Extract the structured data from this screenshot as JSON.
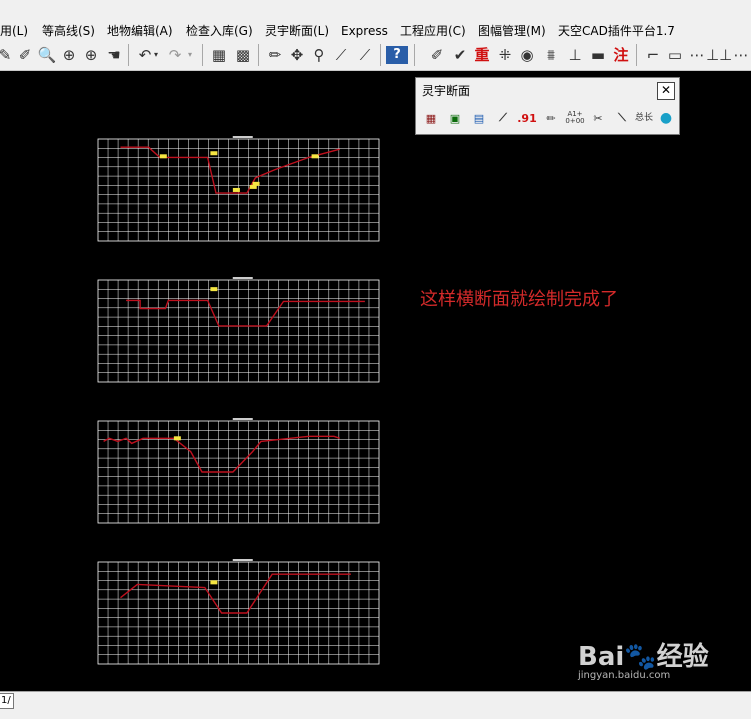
{
  "menubar": {
    "items": [
      "用(L)",
      "等高线(S)",
      "地物编辑(A)",
      "检查入库(G)",
      "灵宇断面(L)",
      "Express",
      "工程应用(C)",
      "图幅管理(M)",
      "天空CAD插件平台1.7"
    ]
  },
  "toolbar": {
    "icons": [
      "pencil-icon",
      "draw-icon",
      "zoom-realtime-icon",
      "zoom-window-icon",
      "zoom-in-icon",
      "pan-hand-icon",
      "undo-icon",
      "dropdown-icon",
      "redo-icon",
      "dropdown-icon",
      "properties-icon",
      "table-icon",
      "line-icon",
      "move-icon",
      "node-icon",
      "extend-icon",
      "trim-icon",
      "help-icon",
      "pick-icon",
      "check-icon",
      "redo-char-icon",
      "grid-icon",
      "camera-icon",
      "road-icon",
      "level-icon",
      "measure-icon",
      "note-icon",
      "corner-icon",
      "rect-icon",
      "dash-icon",
      "gap-icon"
    ],
    "redo_char": "重",
    "note_char": "注",
    "help_char": "?"
  },
  "palette": {
    "title": "灵宇断面",
    "close": "✕",
    "icons": [
      "grid-section-icon",
      "frame-icon",
      "chart-icon",
      "ruler-icon",
      "elevation-icon",
      "stake-icon",
      "chainage-icon",
      "cut-icon",
      "draw-line-icon",
      "length-icon",
      "color-icon"
    ],
    "elevation_label": ".91",
    "chainage_label": "A1+\n0+00",
    "length_label": "总长"
  },
  "sections": [
    {
      "name": "cross-section-1",
      "profile": [
        [
          0.08,
          0.92
        ],
        [
          0.18,
          0.92
        ],
        [
          0.22,
          0.82
        ],
        [
          0.38,
          0.82
        ],
        [
          0.39,
          0.82
        ],
        [
          0.42,
          0.47
        ],
        [
          0.53,
          0.47
        ],
        [
          0.56,
          0.62
        ],
        [
          0.63,
          0.7
        ],
        [
          0.75,
          0.82
        ],
        [
          0.86,
          0.9
        ]
      ],
      "labels": [
        [
          0.22,
          0.85
        ],
        [
          0.4,
          0.88
        ],
        [
          0.48,
          0.52
        ],
        [
          0.54,
          0.55
        ],
        [
          0.55,
          0.58
        ],
        [
          0.76,
          0.85
        ]
      ]
    },
    {
      "name": "cross-section-2",
      "profile": [
        [
          0.1,
          0.8
        ],
        [
          0.15,
          0.8
        ],
        [
          0.15,
          0.72
        ],
        [
          0.24,
          0.72
        ],
        [
          0.25,
          0.8
        ],
        [
          0.39,
          0.8
        ],
        [
          0.43,
          0.55
        ],
        [
          0.6,
          0.55
        ],
        [
          0.66,
          0.79
        ],
        [
          0.95,
          0.79
        ]
      ],
      "labels": [
        [
          0.4,
          0.93
        ]
      ]
    },
    {
      "name": "cross-section-3",
      "profile": [
        [
          0.02,
          0.8
        ],
        [
          0.04,
          0.83
        ],
        [
          0.07,
          0.8
        ],
        [
          0.1,
          0.83
        ],
        [
          0.12,
          0.78
        ],
        [
          0.16,
          0.83
        ],
        [
          0.27,
          0.83
        ],
        [
          0.33,
          0.7
        ],
        [
          0.37,
          0.5
        ],
        [
          0.48,
          0.5
        ],
        [
          0.55,
          0.7
        ],
        [
          0.58,
          0.8
        ],
        [
          0.75,
          0.85
        ],
        [
          0.84,
          0.85
        ],
        [
          0.86,
          0.83
        ]
      ],
      "labels": [
        [
          0.27,
          0.85
        ]
      ]
    },
    {
      "name": "cross-section-4",
      "profile": [
        [
          0.08,
          0.65
        ],
        [
          0.14,
          0.78
        ],
        [
          0.38,
          0.75
        ],
        [
          0.44,
          0.5
        ],
        [
          0.53,
          0.5
        ],
        [
          0.62,
          0.88
        ],
        [
          0.9,
          0.88
        ]
      ],
      "labels": [
        [
          0.4,
          0.82
        ]
      ]
    }
  ],
  "note_text": "这样横断面就绘制完成了",
  "statusbar": {
    "layout_tab": "1/"
  },
  "watermark": {
    "logo": "Bai🐾经验",
    "url": "jingyan.baidu.com"
  },
  "colors": {
    "grid": "#ffffff",
    "profile": "#c0101e",
    "label": "#f5e642",
    "note": "#d42a2a"
  }
}
